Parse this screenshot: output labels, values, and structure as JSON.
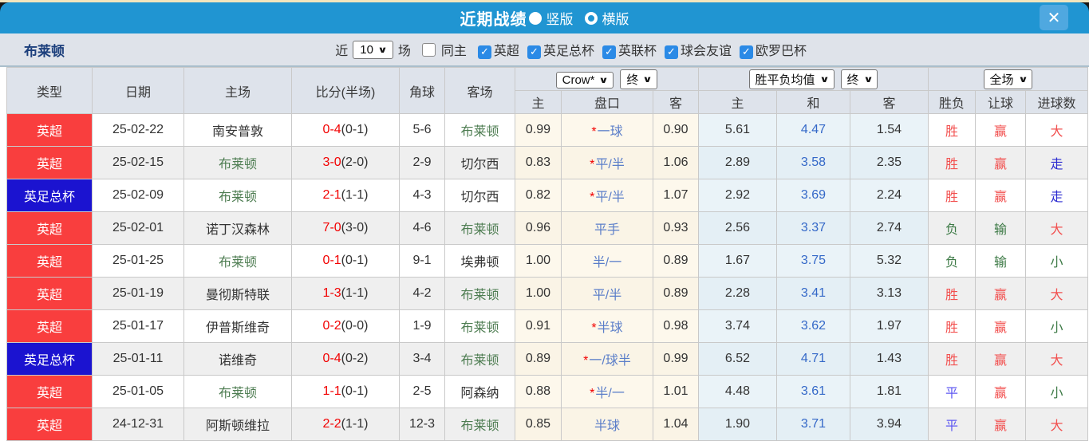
{
  "window": {
    "title": "近期战绩",
    "radio_vertical": "竖版",
    "radio_horizontal": "横版",
    "close_glyph": "✕"
  },
  "filterbar": {
    "team": "布莱顿",
    "near_label": "近",
    "games_count": "10",
    "games_label": "场",
    "same_home_label": "同主",
    "same_home_checked": false,
    "leagues": [
      {
        "label": "英超",
        "checked": true
      },
      {
        "label": "英足总杯",
        "checked": true
      },
      {
        "label": "英联杯",
        "checked": true
      },
      {
        "label": "球会友谊",
        "checked": true
      },
      {
        "label": "欧罗巴杯",
        "checked": true
      }
    ]
  },
  "table": {
    "head": [
      "类型",
      "日期",
      "主场",
      "比分(半场)",
      "角球",
      "客场"
    ],
    "sub": [
      "主",
      "盘口",
      "客",
      "主",
      "和",
      "客",
      "胜负",
      "让球",
      "进球数"
    ],
    "selects": {
      "company": "Crow*",
      "company_state": "终",
      "mean": "胜平负均值",
      "mean_state": "终",
      "scope": "全场"
    },
    "rows": [
      {
        "league": "英超",
        "league_color": "red",
        "date": "25-02-22",
        "home": "南安普敦",
        "home_is_team": false,
        "score": "0-4",
        "half": "(0-1)",
        "corner": "5-6",
        "away": "布莱顿",
        "away_is_team": true,
        "o_home": "0.99",
        "star": true,
        "handicap": "一球",
        "o_away": "0.90",
        "m_home": "5.61",
        "m_draw": "4.47",
        "m_away": "1.54",
        "result": "胜",
        "result_c": "red",
        "let": "赢",
        "let_c": "red",
        "goal": "大",
        "goal_c": "red"
      },
      {
        "league": "英超",
        "league_color": "red",
        "date": "25-02-15",
        "home": "布莱顿",
        "home_is_team": true,
        "score": "3-0",
        "half": "(2-0)",
        "corner": "2-9",
        "away": "切尔西",
        "away_is_team": false,
        "o_home": "0.83",
        "star": true,
        "handicap": "平/半",
        "o_away": "1.06",
        "m_home": "2.89",
        "m_draw": "3.58",
        "m_away": "2.35",
        "result": "胜",
        "result_c": "red",
        "let": "赢",
        "let_c": "red",
        "goal": "走",
        "goal_c": "blue"
      },
      {
        "league": "英足总杯",
        "league_color": "blue",
        "date": "25-02-09",
        "home": "布莱顿",
        "home_is_team": true,
        "score": "2-1",
        "half": "(1-1)",
        "corner": "4-3",
        "away": "切尔西",
        "away_is_team": false,
        "o_home": "0.82",
        "star": true,
        "handicap": "平/半",
        "o_away": "1.07",
        "m_home": "2.92",
        "m_draw": "3.69",
        "m_away": "2.24",
        "result": "胜",
        "result_c": "red",
        "let": "赢",
        "let_c": "red",
        "goal": "走",
        "goal_c": "blue"
      },
      {
        "league": "英超",
        "league_color": "red",
        "date": "25-02-01",
        "home": "诺丁汉森林",
        "home_is_team": false,
        "score": "7-0",
        "half": "(3-0)",
        "corner": "4-6",
        "away": "布莱顿",
        "away_is_team": true,
        "o_home": "0.96",
        "star": false,
        "handicap": "平手",
        "o_away": "0.93",
        "m_home": "2.56",
        "m_draw": "3.37",
        "m_away": "2.74",
        "result": "负",
        "result_c": "green",
        "let": "输",
        "let_c": "green",
        "goal": "大",
        "goal_c": "red"
      },
      {
        "league": "英超",
        "league_color": "red",
        "date": "25-01-25",
        "home": "布莱顿",
        "home_is_team": true,
        "score": "0-1",
        "half": "(0-1)",
        "corner": "9-1",
        "away": "埃弗顿",
        "away_is_team": false,
        "o_home": "1.00",
        "star": false,
        "handicap": "半/一",
        "o_away": "0.89",
        "m_home": "1.67",
        "m_draw": "3.75",
        "m_away": "5.32",
        "result": "负",
        "result_c": "green",
        "let": "输",
        "let_c": "green",
        "goal": "小",
        "goal_c": "green"
      },
      {
        "league": "英超",
        "league_color": "red",
        "date": "25-01-19",
        "home": "曼彻斯特联",
        "home_is_team": false,
        "score": "1-3",
        "half": "(1-1)",
        "corner": "4-2",
        "away": "布莱顿",
        "away_is_team": true,
        "o_home": "1.00",
        "star": false,
        "handicap": "平/半",
        "o_away": "0.89",
        "m_home": "2.28",
        "m_draw": "3.41",
        "m_away": "3.13",
        "result": "胜",
        "result_c": "red",
        "let": "赢",
        "let_c": "red",
        "goal": "大",
        "goal_c": "red"
      },
      {
        "league": "英超",
        "league_color": "red",
        "date": "25-01-17",
        "home": "伊普斯维奇",
        "home_is_team": false,
        "score": "0-2",
        "half": "(0-0)",
        "corner": "1-9",
        "away": "布莱顿",
        "away_is_team": true,
        "o_home": "0.91",
        "star": true,
        "handicap": "半球",
        "o_away": "0.98",
        "m_home": "3.74",
        "m_draw": "3.62",
        "m_away": "1.97",
        "result": "胜",
        "result_c": "red",
        "let": "赢",
        "let_c": "red",
        "goal": "小",
        "goal_c": "green"
      },
      {
        "league": "英足总杯",
        "league_color": "blue",
        "date": "25-01-11",
        "home": "诺维奇",
        "home_is_team": false,
        "score": "0-4",
        "half": "(0-2)",
        "corner": "3-4",
        "away": "布莱顿",
        "away_is_team": true,
        "o_home": "0.89",
        "star": true,
        "handicap": "一/球半",
        "o_away": "0.99",
        "m_home": "6.52",
        "m_draw": "4.71",
        "m_away": "1.43",
        "result": "胜",
        "result_c": "red",
        "let": "赢",
        "let_c": "red",
        "goal": "大",
        "goal_c": "red"
      },
      {
        "league": "英超",
        "league_color": "red",
        "date": "25-01-05",
        "home": "布莱顿",
        "home_is_team": true,
        "score": "1-1",
        "half": "(0-1)",
        "corner": "2-5",
        "away": "阿森纳",
        "away_is_team": false,
        "o_home": "0.88",
        "star": true,
        "handicap": "半/一",
        "o_away": "1.01",
        "m_home": "4.48",
        "m_draw": "3.61",
        "m_away": "1.81",
        "result": "平",
        "result_c": "purple",
        "let": "赢",
        "let_c": "red",
        "goal": "小",
        "goal_c": "green"
      },
      {
        "league": "英超",
        "league_color": "red",
        "date": "24-12-31",
        "home": "阿斯顿维拉",
        "home_is_team": false,
        "score": "2-2",
        "half": "(1-1)",
        "corner": "12-3",
        "away": "布莱顿",
        "away_is_team": true,
        "o_home": "0.85",
        "star": false,
        "handicap": "半球",
        "o_away": "1.04",
        "m_home": "1.90",
        "m_draw": "3.71",
        "m_away": "3.94",
        "result": "平",
        "result_c": "purple",
        "let": "赢",
        "let_c": "red",
        "goal": "大",
        "goal_c": "red"
      }
    ]
  },
  "colors": {
    "titlebar_blue": "#2095d2",
    "league_red": "#f93e3e",
    "league_blue": "#1b13d0",
    "score_red": "#f20000",
    "team_green": "#4e7d52",
    "handicap_blue": "#5b7ec9",
    "mean_draw_blue": "#3468c8",
    "win_red": "#f2504f",
    "lose_green": "#3d7a46",
    "draw_purple": "#5e58f2",
    "go_blue": "#2a2ad0",
    "odds_col_bg": "#fdf8ec",
    "mean_col_bg": "#eaf3f8"
  }
}
